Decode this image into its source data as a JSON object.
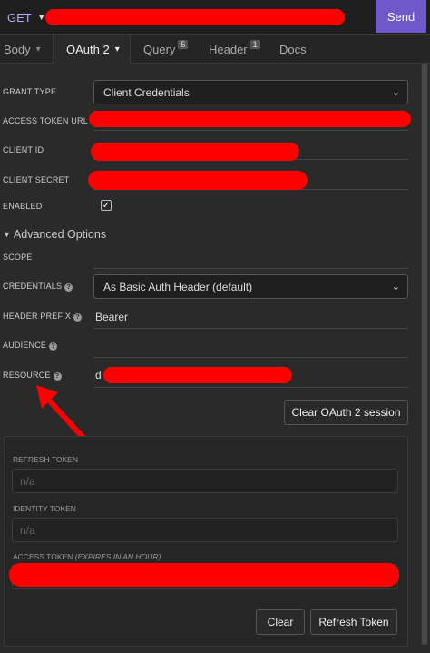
{
  "topbar": {
    "method": "GET",
    "send_label": "Send"
  },
  "tabs": [
    {
      "label": "Body",
      "caret": "▾"
    },
    {
      "label": "OAuth 2",
      "caret": "▾"
    },
    {
      "label": "Query",
      "badge": "5"
    },
    {
      "label": "Header",
      "badge": "1"
    },
    {
      "label": "Docs"
    }
  ],
  "form": {
    "grant_type": {
      "label": "GRANT TYPE",
      "value": "Client Credentials"
    },
    "access_token_url": {
      "label": "ACCESS TOKEN URL"
    },
    "client_id": {
      "label": "CLIENT ID"
    },
    "client_secret": {
      "label": "CLIENT SECRET"
    },
    "enabled": {
      "label": "ENABLED",
      "checked": true
    },
    "advanced_toggle": "Advanced Options",
    "scope": {
      "label": "SCOPE"
    },
    "credentials": {
      "label": "CREDENTIALS",
      "value": "As Basic Auth Header (default)"
    },
    "header_prefix": {
      "label": "HEADER PREFIX",
      "value": "Bearer"
    },
    "audience": {
      "label": "AUDIENCE"
    },
    "resource": {
      "label": "RESOURCE",
      "value": "d"
    },
    "clear_session_label": "Clear OAuth 2 session"
  },
  "tokens": {
    "refresh": {
      "label": "REFRESH TOKEN",
      "placeholder": "n/a"
    },
    "identity": {
      "label": "IDENTITY TOKEN",
      "placeholder": "n/a"
    },
    "access": {
      "label": "ACCESS TOKEN",
      "note": "(EXPIRES IN AN HOUR)"
    },
    "clear_label": "Clear",
    "refresh_label": "Refresh Token"
  },
  "colors": {
    "accent": "#6f59c9",
    "redaction": "#ff0000",
    "annotation_arrow": "#ff0000"
  }
}
